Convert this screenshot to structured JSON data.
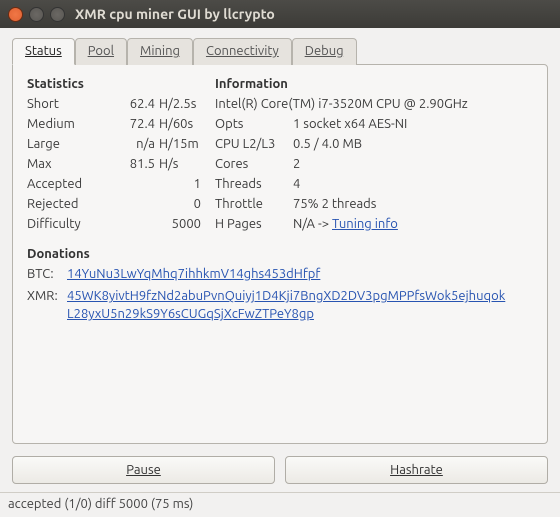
{
  "window": {
    "title": "XMR cpu miner GUI by llcrypto"
  },
  "tabs": {
    "status": "Status",
    "pool": "Pool",
    "mining": "Mining",
    "connectivity": "Connectivity",
    "debug": "Debug"
  },
  "stats": {
    "header": "Statistics",
    "rows": {
      "short": {
        "label": "Short",
        "value": "62.4",
        "unit": "H/2.5s"
      },
      "medium": {
        "label": "Medium",
        "value": "72.4",
        "unit": "H/60s"
      },
      "large": {
        "label": "Large",
        "value": "n/a",
        "unit": "H/15m"
      },
      "max": {
        "label": "Max",
        "value": "81.5",
        "unit": "H/s"
      },
      "accepted": {
        "label": "Accepted",
        "value": "1",
        "unit": ""
      },
      "rejected": {
        "label": "Rejected",
        "value": "0",
        "unit": ""
      },
      "difficulty": {
        "label": "Difficulty",
        "value": "5000",
        "unit": ""
      }
    }
  },
  "info": {
    "header": "Information",
    "cpu": "Intel(R) Core(TM) i7-3520M CPU @ 2.90GHz",
    "opts_l": "Opts",
    "opts": "1 socket x64 AES-NI",
    "cache_l": "CPU L2/L3",
    "cache": "0.5 / 4.0 MB",
    "cores_l": "Cores",
    "cores": "2",
    "threads_l": "Threads",
    "threads": "4",
    "throttle_l": "Throttle",
    "throttle": "75% 2 threads",
    "hpages_l": "H Pages",
    "hpages_prefix": "N/A -> ",
    "hpages_link": "Tuning info"
  },
  "donations": {
    "header": "Donations",
    "btc_l": "BTC:",
    "btc": "14YuNu3LwYqMhq7ihhkmV14ghs453dHfpf",
    "xmr_l": "XMR:",
    "xmr": "45WK8yivtH9fzNd2abuPvnQuiyj1D4Kji7BngXD2DV3pgMPPfsWok5ejhuqokL28yxU5n29kS9Y6sCUGqSjXcFwZTPeY8gp"
  },
  "buttons": {
    "pause": "Pause",
    "hashrate": "Hashrate"
  },
  "statusbar": "accepted (1/0) diff 5000 (75 ms)"
}
